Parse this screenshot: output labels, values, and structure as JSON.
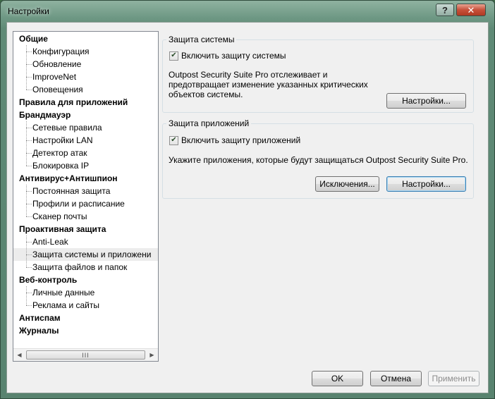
{
  "window": {
    "title": "Настройки",
    "help_label": "?",
    "close_label": "✕"
  },
  "tree": {
    "items": [
      {
        "label": "Общие",
        "level": 0
      },
      {
        "label": "Конфигурация",
        "level": 1
      },
      {
        "label": "Обновление",
        "level": 1
      },
      {
        "label": "ImproveNet",
        "level": 1
      },
      {
        "label": "Оповещения",
        "level": 1
      },
      {
        "label": "Правила для приложений",
        "level": 0
      },
      {
        "label": "Брандмауэр",
        "level": 0
      },
      {
        "label": "Сетевые правила",
        "level": 1
      },
      {
        "label": "Настройки LAN",
        "level": 1
      },
      {
        "label": "Детектор атак",
        "level": 1
      },
      {
        "label": "Блокировка IP",
        "level": 1
      },
      {
        "label": "Антивирус+Антишпион",
        "level": 0
      },
      {
        "label": "Постоянная защита",
        "level": 1
      },
      {
        "label": "Профили и расписание",
        "level": 1
      },
      {
        "label": "Сканер почты",
        "level": 1
      },
      {
        "label": "Проактивная защита",
        "level": 0
      },
      {
        "label": "Anti-Leak",
        "level": 1
      },
      {
        "label": "Защита системы и приложени",
        "level": 1,
        "selected": true
      },
      {
        "label": "Защита файлов и папок",
        "level": 1
      },
      {
        "label": "Веб-контроль",
        "level": 0
      },
      {
        "label": "Личные данные",
        "level": 1
      },
      {
        "label": "Реклама и сайты",
        "level": 1
      },
      {
        "label": "Антиспам",
        "level": 0
      },
      {
        "label": "Журналы",
        "level": 0
      }
    ],
    "scroll_left": "◀",
    "scroll_right": "▶",
    "scroll_grip": "III"
  },
  "system_protection": {
    "title": "Защита системы",
    "checkbox_label": "Включить защиту системы",
    "checked": true,
    "description_line1": "Outpost Security Suite Pro отслеживает и",
    "description_line2": "предотвращает изменение указанных критических",
    "description_line3": "объектов системы.",
    "settings_label": "Настройки..."
  },
  "app_protection": {
    "title": "Защита приложений",
    "checkbox_label": "Включить защиту приложений",
    "checked": true,
    "description": "Укажите приложения, которые будут защищаться Outpost Security Suite Pro.",
    "exceptions_label": "Исключения...",
    "settings_label": "Настройки..."
  },
  "footer": {
    "ok_label": "OK",
    "cancel_label": "Отмена",
    "apply_label": "Применить"
  },
  "colors": {
    "accent": "#3c7fb1",
    "titlebar": "#6e9884",
    "close_button": "#c7503a"
  }
}
